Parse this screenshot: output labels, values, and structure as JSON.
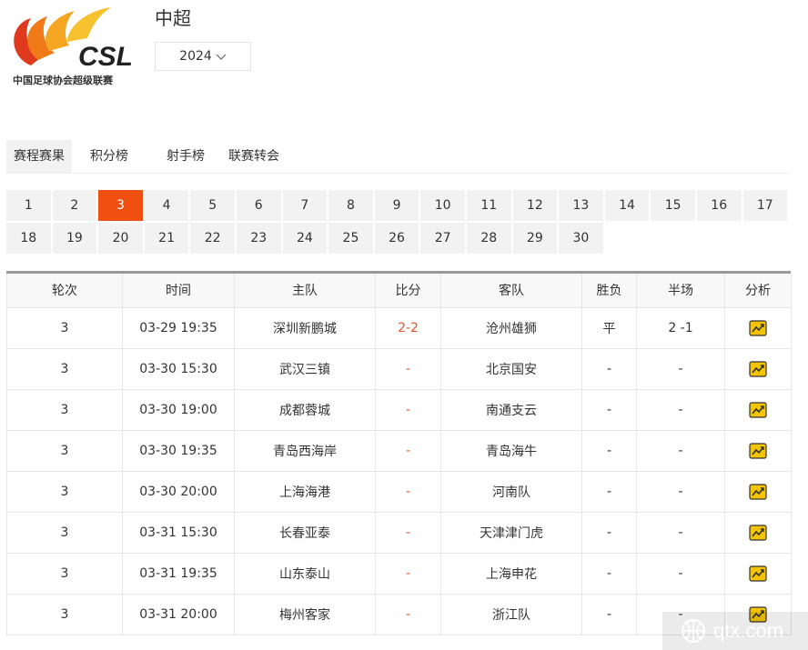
{
  "logo": {
    "mark": "CSL",
    "caption": "中国足球协会超级联赛"
  },
  "header": {
    "title": "中超",
    "season": "2024"
  },
  "tabs": [
    {
      "label": "赛程赛果",
      "active": true
    },
    {
      "label": "积分榜",
      "active": false
    },
    {
      "label": "射手榜",
      "active": false
    },
    {
      "label": "联赛转会",
      "active": false
    }
  ],
  "rounds": {
    "row1": [
      "1",
      "2",
      "3",
      "4",
      "5",
      "6",
      "7",
      "8",
      "9",
      "10",
      "11",
      "12",
      "13",
      "14",
      "15",
      "16",
      "17"
    ],
    "row2": [
      "18",
      "19",
      "20",
      "21",
      "22",
      "23",
      "24",
      "25",
      "26",
      "27",
      "28",
      "29",
      "30"
    ],
    "selected": "3",
    "active_color": "#f04f12"
  },
  "table": {
    "headers": [
      "轮次",
      "时间",
      "主队",
      "比分",
      "客队",
      "胜负",
      "半场",
      "分析"
    ],
    "rows": [
      {
        "round": "3",
        "time": "03-29 19:35",
        "home": "深圳新鹏城",
        "score": "2-2",
        "away": "沧州雄狮",
        "result": "平",
        "half": "2 -1"
      },
      {
        "round": "3",
        "time": "03-30 15:30",
        "home": "武汉三镇",
        "score": "-",
        "away": "北京国安",
        "result": "-",
        "half": "-"
      },
      {
        "round": "3",
        "time": "03-30 19:00",
        "home": "成都蓉城",
        "score": "-",
        "away": "南通支云",
        "result": "-",
        "half": "-"
      },
      {
        "round": "3",
        "time": "03-30 19:35",
        "home": "青岛西海岸",
        "score": "-",
        "away": "青岛海牛",
        "result": "-",
        "half": "-"
      },
      {
        "round": "3",
        "time": "03-30 20:00",
        "home": "上海海港",
        "score": "-",
        "away": "河南队",
        "result": "-",
        "half": "-"
      },
      {
        "round": "3",
        "time": "03-31 15:30",
        "home": "长春亚泰",
        "score": "-",
        "away": "天津津门虎",
        "result": "-",
        "half": "-"
      },
      {
        "round": "3",
        "time": "03-31 19:35",
        "home": "山东泰山",
        "score": "-",
        "away": "上海申花",
        "result": "-",
        "half": "-"
      },
      {
        "round": "3",
        "time": "03-31 20:00",
        "home": "梅州客家",
        "score": "-",
        "away": "浙江队",
        "result": "-",
        "half": "-"
      }
    ]
  },
  "watermark": {
    "text": "qtx.com"
  },
  "colors": {
    "accent": "#f04f12",
    "score": "#e8542c",
    "icon_yellow": "#f5c400"
  }
}
